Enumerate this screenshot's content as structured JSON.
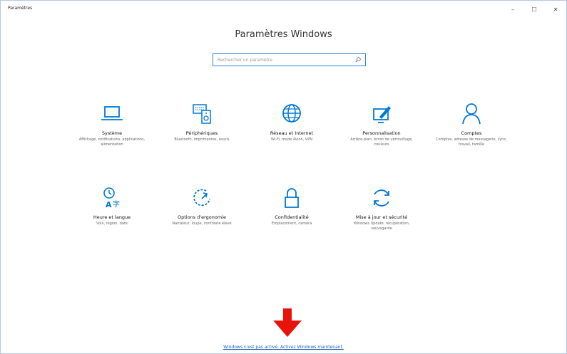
{
  "window": {
    "app_title": "Paramètres",
    "minimize": "–",
    "maximize": "☐",
    "close": "✕"
  },
  "header": {
    "title": "Paramètres Windows"
  },
  "search": {
    "placeholder": "Rechercher un paramètre",
    "icon": "search-icon"
  },
  "tiles": [
    {
      "name": "Système",
      "desc": "Affichage, notifications, applications, alimentation",
      "icon": "laptop-icon"
    },
    {
      "name": "Périphériques",
      "desc": "Bluetooth, imprimantes, souris",
      "icon": "devices-icon"
    },
    {
      "name": "Réseau et Internet",
      "desc": "Wi-Fi, mode Avion, VPN",
      "icon": "globe-icon"
    },
    {
      "name": "Personnalisation",
      "desc": "Arrière-plan, écran de verrouillage, couleurs",
      "icon": "personalization-icon"
    },
    {
      "name": "Comptes",
      "desc": "Comptes, adresse de messagerie, sync, travail, famille",
      "icon": "person-icon"
    },
    {
      "name": "Heure et langue",
      "desc": "Voix, région, date",
      "icon": "time-language-icon"
    },
    {
      "name": "Options d'ergonomie",
      "desc": "Narrateur, loupe, contraste élevé",
      "icon": "ease-of-access-icon"
    },
    {
      "name": "Confidentialité",
      "desc": "Emplacement, caméra",
      "icon": "lock-icon"
    },
    {
      "name": "Mise à jour et sécurité",
      "desc": "Windows Update, récupération, sauvegarde",
      "icon": "refresh-icon"
    }
  ],
  "activation": {
    "link_text": "Windows n'est pas activé. Activez Windows maintenant."
  },
  "colors": {
    "accent": "#0078d7",
    "arrow": "#e8140c"
  }
}
